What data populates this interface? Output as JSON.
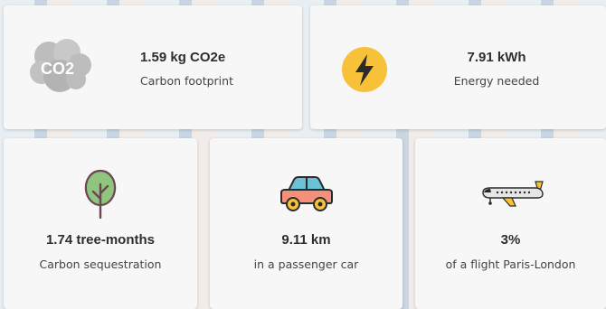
{
  "cards": [
    {
      "value": "1.59 kg CO2e",
      "label": "Carbon footprint",
      "icon": "co2-cloud-icon",
      "icon_text": "CO2"
    },
    {
      "value": "7.91 kWh",
      "label": "Energy needed",
      "icon": "lightning-bolt-icon"
    },
    {
      "value": "1.74 tree-months",
      "label": "Carbon sequestration",
      "icon": "tree-icon"
    },
    {
      "value": "9.11 km",
      "label": "in a passenger car",
      "icon": "car-icon"
    },
    {
      "value": "3%",
      "label": "of a flight Paris-London",
      "icon": "airplane-icon"
    }
  ],
  "colors": {
    "card_bg": "#f7f7f7",
    "bolt_circle": "#f8c13a",
    "tree_green": "#8fc57f",
    "car_body": "#f49079",
    "car_window": "#6bc2d6",
    "wheel_yellow": "#f8c13a"
  }
}
